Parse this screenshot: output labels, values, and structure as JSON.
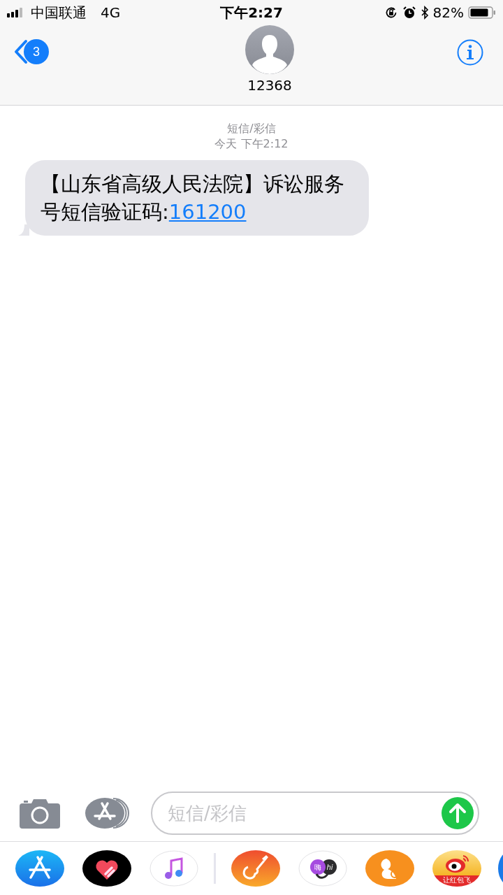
{
  "status_bar": {
    "carrier": "中国联通",
    "network": "4G",
    "time": "下午2:27",
    "battery": "82%"
  },
  "header": {
    "unread_count": "3",
    "contact": "12368"
  },
  "conversation": {
    "service": "短信/彩信",
    "timestamp": "今天 下午2:12",
    "messages": [
      {
        "text": "【山东省高级人民法院】诉讼服务号短信验证码:",
        "code": "161200"
      }
    ]
  },
  "composer": {
    "placeholder": "短信/彩信"
  },
  "app_drawer": [
    {
      "kind": "appstore"
    },
    {
      "kind": "heart"
    },
    {
      "kind": "music"
    },
    {
      "kind": "divider"
    },
    {
      "kind": "guitar"
    },
    {
      "kind": "chat",
      "texts": [
        "嗨",
        "hi"
      ]
    },
    {
      "kind": "squirrel"
    },
    {
      "kind": "weibo",
      "texts": [
        "让红包飞"
      ]
    },
    {
      "kind": "partial"
    }
  ]
}
